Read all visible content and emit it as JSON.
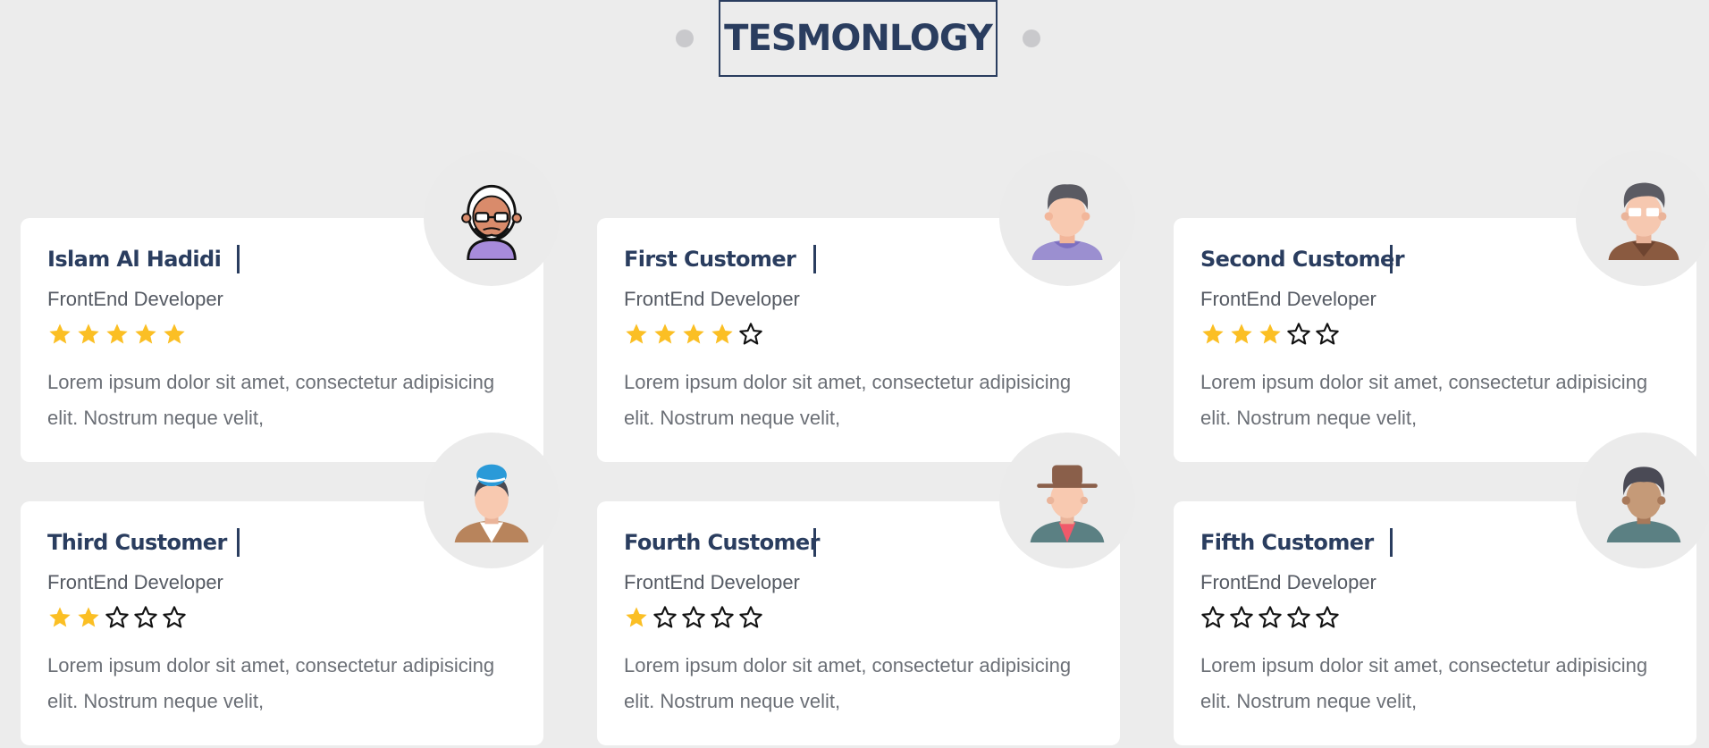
{
  "section": {
    "title": "TESMONLOGY"
  },
  "colors": {
    "accent": "#2a3d5f",
    "star_filled": "#fbbf24",
    "star_empty_stroke": "#111111",
    "card_bg": "#ffffff",
    "page_bg": "#ececec"
  },
  "cards": [
    {
      "name": "Islam Al Hadidi",
      "role": "FrontEnd Developer",
      "rating": 5,
      "rating_max": 5,
      "text": "Lorem ipsum dolor sit amet, consectetur adipisicing elit. Nostrum neque velit,",
      "avatar_icon": "old-man-glasses-avatar-icon"
    },
    {
      "name": "First Customer",
      "role": "FrontEnd Developer",
      "rating": 4,
      "rating_max": 5,
      "text": "Lorem ipsum dolor sit amet, consectetur adipisicing elit. Nostrum neque velit,",
      "avatar_icon": "man-purple-shirt-avatar-icon"
    },
    {
      "name": "Second Customer",
      "role": "FrontEnd Developer",
      "rating": 3,
      "rating_max": 5,
      "text": "Lorem ipsum dolor sit amet, consectetur adipisicing elit. Nostrum neque velit,",
      "avatar_icon": "man-glasses-brown-jacket-avatar-icon"
    },
    {
      "name": "Third Customer",
      "role": "FrontEnd Developer",
      "rating": 2,
      "rating_max": 5,
      "text": "Lorem ipsum dolor sit amet, consectetur adipisicing elit. Nostrum neque velit,",
      "avatar_icon": "woman-blue-hat-avatar-icon"
    },
    {
      "name": "Fourth Customer",
      "role": "FrontEnd Developer",
      "rating": 1,
      "rating_max": 5,
      "text": "Lorem ipsum dolor sit amet, consectetur adipisicing elit. Nostrum neque velit,",
      "avatar_icon": "man-fedora-hat-avatar-icon"
    },
    {
      "name": "Fifth Customer",
      "role": "FrontEnd Developer",
      "rating": 0,
      "rating_max": 5,
      "text": "Lorem ipsum dolor sit amet, consectetur adipisicing elit. Nostrum neque velit,",
      "avatar_icon": "man-dark-hair-avatar-icon"
    }
  ]
}
